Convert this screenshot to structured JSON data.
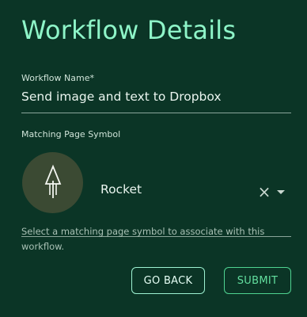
{
  "page": {
    "title": "Workflow Details"
  },
  "workflow_name": {
    "label": "Workflow Name*",
    "value": "Send image and text to Dropbox"
  },
  "page_symbol": {
    "label": "Matching Page Symbol",
    "selected_value": "Rocket",
    "symbol_icon": "rocket-icon",
    "clear_icon": "close-icon",
    "dropdown_icon": "caret-down-icon",
    "clear_glyph": "×",
    "helper_text": "Select a matching page symbol to associate with this workflow."
  },
  "actions": {
    "back_label": "GO BACK",
    "submit_label": "SUBMIT"
  },
  "colors": {
    "background": "#0b3526",
    "title": "#8ef5c8",
    "back_border": "#9ef2d2",
    "submit": "#4fd391",
    "avatar_bg": "#3b4a33"
  }
}
